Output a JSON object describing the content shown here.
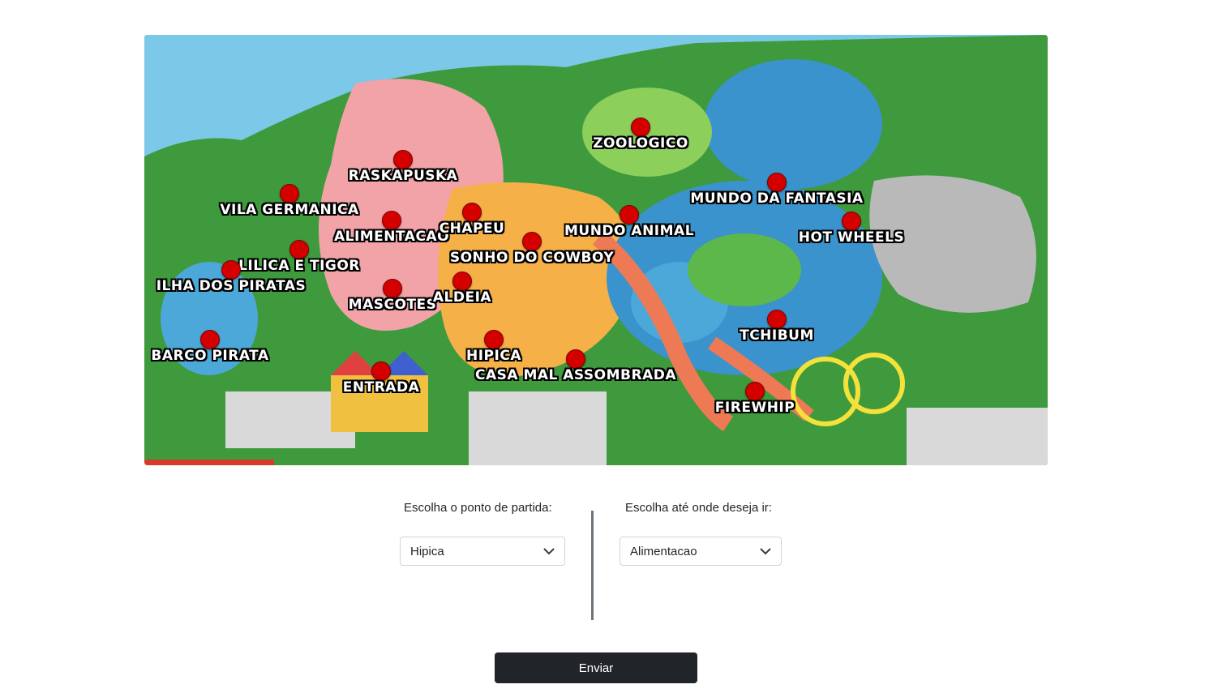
{
  "map": {
    "points": [
      {
        "label": "Raskapuska"
      },
      {
        "label": "Zoologico"
      },
      {
        "label": "Vila Germanica"
      },
      {
        "label": "Alimentacao"
      },
      {
        "label": "Chapeu"
      },
      {
        "label": "Mundo da Fantasia"
      },
      {
        "label": "Mundo Animal"
      },
      {
        "label": "Hot Wheels"
      },
      {
        "label": "Lilica e Tigor"
      },
      {
        "label": "Sonho do Cowboy"
      },
      {
        "label": "Ilha dos Piratas"
      },
      {
        "label": "Mascotes"
      },
      {
        "label": "Aldeia"
      },
      {
        "label": "Tchibum"
      },
      {
        "label": "Barco Pirata"
      },
      {
        "label": "Hipica"
      },
      {
        "label": "Entrada"
      },
      {
        "label": "Casa Mal Assombrada"
      },
      {
        "label": "Firewhip"
      }
    ]
  },
  "form": {
    "origin_label": "Escolha o ponto de partida:",
    "origin_value": "Hipica",
    "destination_label": "Escolha até onde deseja ir:",
    "destination_value": "Alimentacao",
    "submit_label": "Enviar"
  }
}
